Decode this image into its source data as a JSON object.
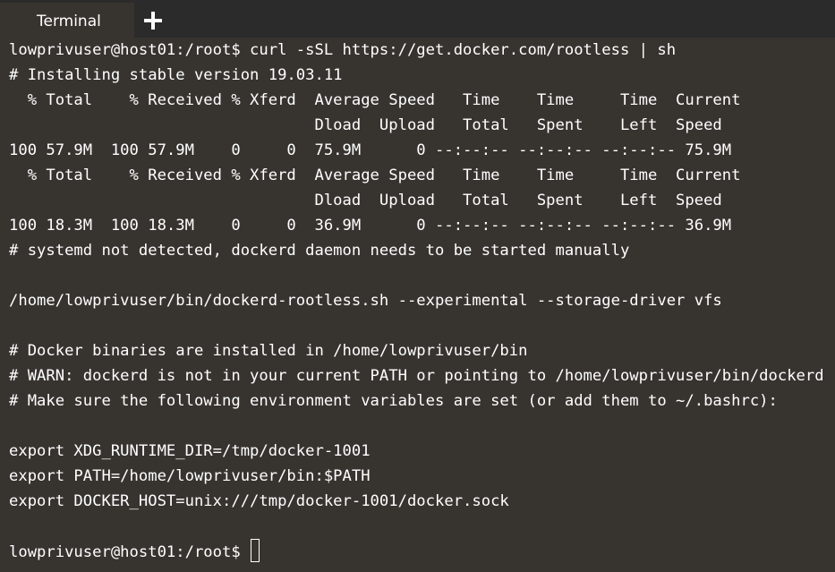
{
  "tabs": [
    {
      "label": "Terminal"
    }
  ],
  "terminal": {
    "lines": [
      "lowprivuser@host01:/root$ curl -sSL https://get.docker.com/rootless | sh",
      "# Installing stable version 19.03.11",
      "  % Total    % Received % Xferd  Average Speed   Time    Time     Time  Current",
      "                                 Dload  Upload   Total   Spent    Left  Speed",
      "100 57.9M  100 57.9M    0     0  75.9M      0 --:--:-- --:--:-- --:--:-- 75.9M",
      "  % Total    % Received % Xferd  Average Speed   Time    Time     Time  Current",
      "                                 Dload  Upload   Total   Spent    Left  Speed",
      "100 18.3M  100 18.3M    0     0  36.9M      0 --:--:-- --:--:-- --:--:-- 36.9M",
      "# systemd not detected, dockerd daemon needs to be started manually",
      "",
      "/home/lowprivuser/bin/dockerd-rootless.sh --experimental --storage-driver vfs",
      "",
      "# Docker binaries are installed in /home/lowprivuser/bin",
      "# WARN: dockerd is not in your current PATH or pointing to /home/lowprivuser/bin/dockerd",
      "# Make sure the following environment variables are set (or add them to ~/.bashrc):",
      "",
      "export XDG_RUNTIME_DIR=/tmp/docker-1001",
      "export PATH=/home/lowprivuser/bin:$PATH",
      "export DOCKER_HOST=unix:///tmp/docker-1001/docker.sock",
      ""
    ],
    "prompt": "lowprivuser@host01:/root$ "
  }
}
